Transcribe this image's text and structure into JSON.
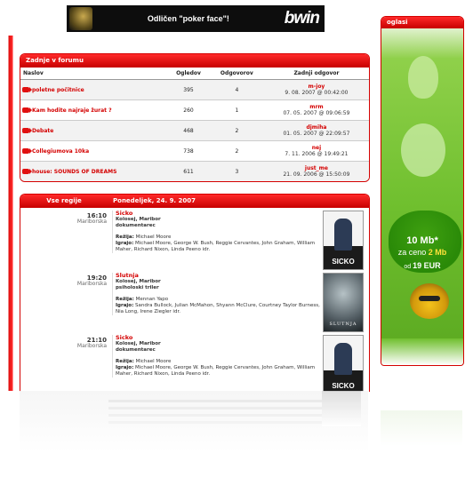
{
  "banner": {
    "text": "Odličen \"poker face\"!",
    "brand": "bwin"
  },
  "forum": {
    "title": "Zadnje v forumu",
    "columns": [
      "Naslov",
      "Ogledov",
      "Odgovorov",
      "Zadnji odgovor"
    ],
    "rows": [
      {
        "title": "poletne počitnice",
        "views": "395",
        "replies": "4",
        "user": "m-joy",
        "date": "9. 08. 2007 @ 00:42:00"
      },
      {
        "title": "Kam hodite najraje žurat ?",
        "views": "260",
        "replies": "1",
        "user": "mrm",
        "date": "07. 05. 2007 @ 09:06:59"
      },
      {
        "title": "Debate",
        "views": "468",
        "replies": "2",
        "user": "djmiha",
        "date": "01. 05. 2007 @ 22:09:57"
      },
      {
        "title": "Collegiumova 10ka",
        "views": "738",
        "replies": "2",
        "user": "nej",
        "date": "7. 11. 2006 @ 19:49:21"
      },
      {
        "title": "house: SOUNDS OF DREAMS",
        "views": "611",
        "replies": "3",
        "user": "just_me",
        "date": "21. 09. 2006 @ 15:50:09"
      }
    ]
  },
  "cinema": {
    "tab": "Vse regije",
    "date": "Ponedeljek, 24. 9. 2007",
    "entries": [
      {
        "time": "16:10",
        "region": "Mariborska",
        "film": "Sicko",
        "venue": "Kolosej, Maribor",
        "genre": "dokumentarec",
        "director_label": "Režija:",
        "director": "Michael Moore",
        "cast_label": "Igrajo:",
        "cast": "Michael Moore, George W. Bush, Reggie Cervantes, John Graham, William Maher, Richard Nixon, Linda Peeno idr.",
        "poster": "SICKO"
      },
      {
        "time": "19:20",
        "region": "Mariborska",
        "film": "Slutnja",
        "venue": "Kolosej, Maribor",
        "genre": "psiholoski triler",
        "director_label": "Režija:",
        "director": "Mennan Yapo",
        "cast_label": "Igrajo:",
        "cast": "Sandra Bullock, Julian McMahon, Shyann McClure, Courtney Taylor Burness, Nia Long, Irene Ziegler idr.",
        "poster": "SLUTNJA"
      },
      {
        "time": "21:10",
        "region": "Mariborska",
        "film": "Sicko",
        "venue": "Kolosej, Maribor",
        "genre": "dokumentarec",
        "director_label": "Režija:",
        "director": "Michael Moore",
        "cast_label": "Igrajo:",
        "cast": "Michael Moore, George W. Bush, Reggie Cervantes, John Graham, William Maher, Richard Nixon, Linda Peeno idr.",
        "poster": "SICKO"
      }
    ]
  },
  "ad": {
    "title": "oglasi",
    "line1": "10 Mb*",
    "line2a": "za ceno",
    "line2b": "2 Mb",
    "line3a": "od",
    "line3b": "19 EUR"
  },
  "colors": {
    "accent": "#d40000",
    "ad_green": "#6fbf2e"
  }
}
